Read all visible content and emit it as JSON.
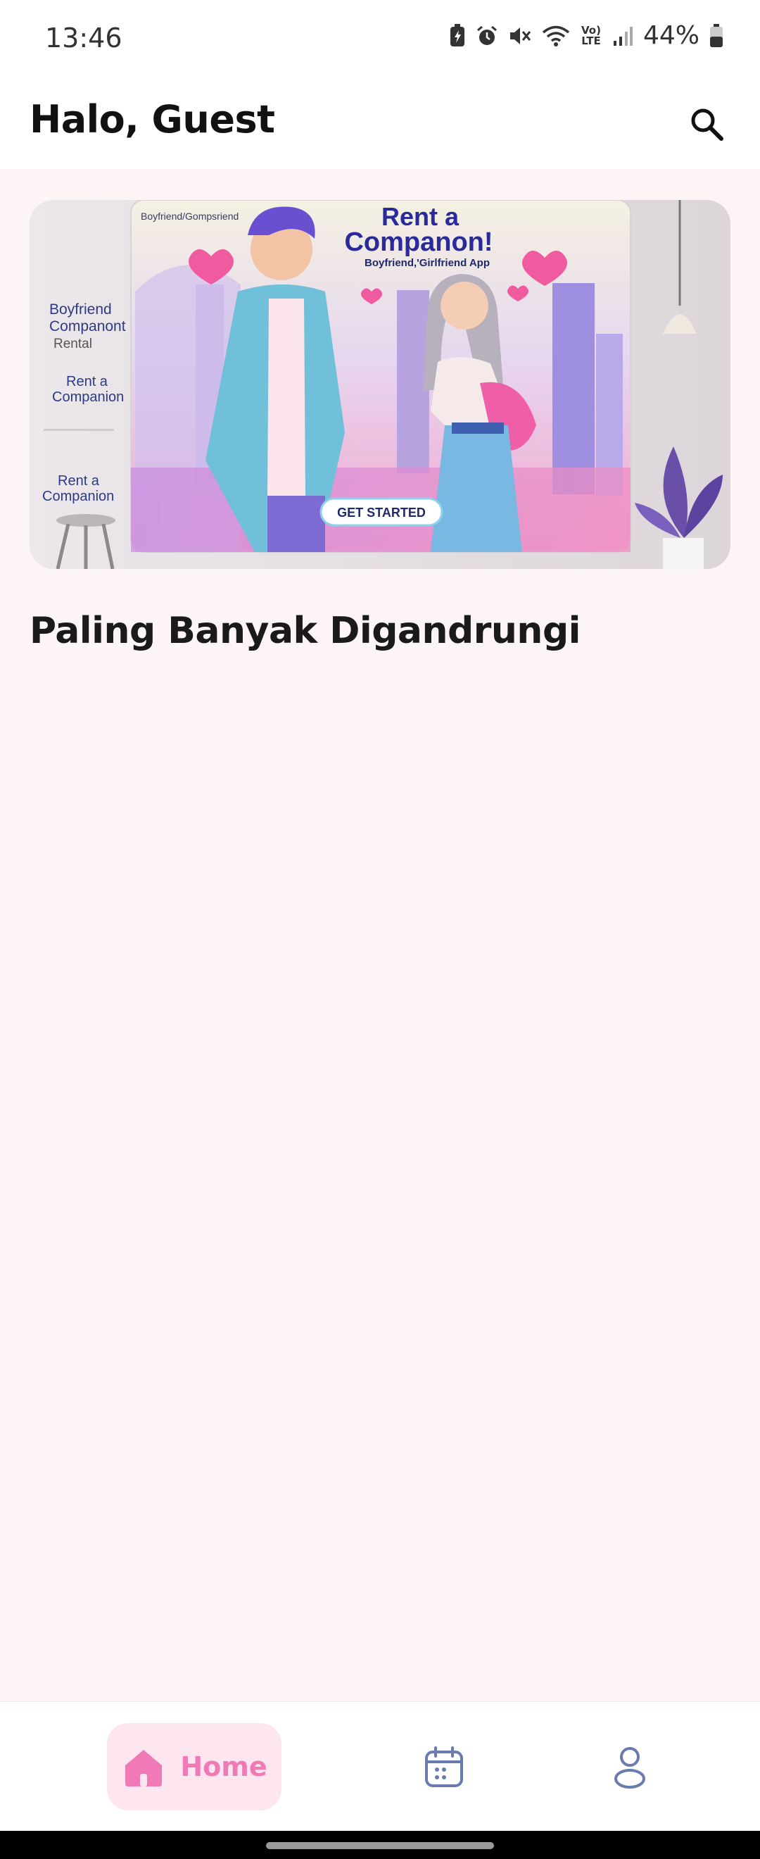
{
  "status_bar": {
    "time": "13:46",
    "battery_percent": "44%",
    "lte_label": "Vo) LTE",
    "icons": [
      "battery-saver-icon",
      "alarm-icon",
      "mute-icon",
      "wifi-icon",
      "volte-icon",
      "signal-icon",
      "battery-icon"
    ]
  },
  "header": {
    "greeting": "Halo, Guest",
    "search_icon": "search-icon"
  },
  "banner": {
    "corner_label": "Boyfriend/Gompsriend",
    "headline_line1": "Rent a",
    "headline_line2": "Companon!",
    "subtitle": "Boyfriend,'Girlfriend App",
    "cta_label": "GET STARTED",
    "wall_text_1_line1": "Boyfriend",
    "wall_text_1_line2": "Companont",
    "wall_text_1_line3": "Rental",
    "wall_text_2_line1": "Rent a",
    "wall_text_2_line2": "Companion",
    "wall_text_3_line1": "Rent a",
    "wall_text_3_line2": "Companion",
    "colors": {
      "headline": "#2a2a9a",
      "cta_bg": "#ffffff",
      "cta_text": "#1f2a6b"
    }
  },
  "sections": {
    "popular_title": "Paling Banyak Digandrungi"
  },
  "bottom_nav": {
    "items": [
      {
        "label": "Home",
        "icon": "home-icon",
        "active": true
      },
      {
        "label": "",
        "icon": "calendar-icon",
        "active": false
      },
      {
        "label": "",
        "icon": "profile-icon",
        "active": false
      }
    ],
    "active_color": "#f07ab5",
    "inactive_color": "#6a7bb0"
  }
}
